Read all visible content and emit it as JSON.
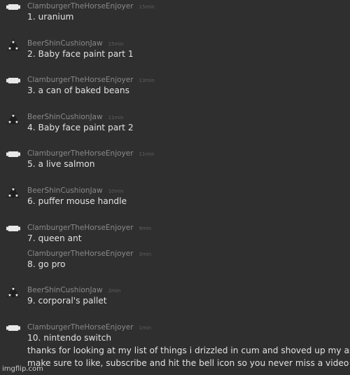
{
  "comments": [
    {
      "username": "ClamburgerTheHorseEnjoyer",
      "time": "15min",
      "text": "1. uranium",
      "avatar": "bone-avatar-icon"
    },
    {
      "username": "BeerShinCushionJaw",
      "time": "15min",
      "text": "2. Baby face paint part 1",
      "avatar": "triangle-stars-avatar-icon"
    },
    {
      "username": "ClamburgerTheHorseEnjoyer",
      "time": "13min",
      "text": "3. a can of baked beans",
      "avatar": "bone-avatar-icon"
    },
    {
      "username": "BeerShinCushionJaw",
      "time": "11min",
      "text": "4. Baby face paint part 2",
      "avatar": "triangle-stars-avatar-icon"
    },
    {
      "username": "ClamburgerTheHorseEnjoyer",
      "time": "11min",
      "text": "5. a live salmon",
      "avatar": "bone-avatar-icon"
    },
    {
      "username": "BeerShinCushionJaw",
      "time": "10min",
      "text": "6. puffer mouse handle",
      "avatar": "triangle-stars-avatar-icon"
    },
    {
      "username": "ClamburgerTheHorseEnjoyer",
      "time": "9min",
      "text": "7. queen ant",
      "avatar": "bone-avatar-icon"
    },
    {
      "username": "ClamburgerTheHorseEnjoyer",
      "time": "3min",
      "text": "8. go pro",
      "avatar": "none"
    },
    {
      "username": "BeerShinCushionJaw",
      "time": "2min",
      "text": "9. corporal's pallet",
      "avatar": "triangle-stars-avatar-icon"
    },
    {
      "username": "ClamburgerTheHorseEnjoyer",
      "time": "1min",
      "text": "10. nintendo switch",
      "avatar": "bone-avatar-icon",
      "extra_lines": [
        "thanks for looking at my list of things i drizzled in cum and shoved up my ass",
        "make sure to like, subscribe and hit the bell icon so you never miss a video"
      ]
    }
  ],
  "watermark": "imgflip.com",
  "colors": {
    "background": "#2f2f2f",
    "username": "#8a8a8a",
    "time": "#5f5f5f",
    "text": "#e2e2e2"
  }
}
